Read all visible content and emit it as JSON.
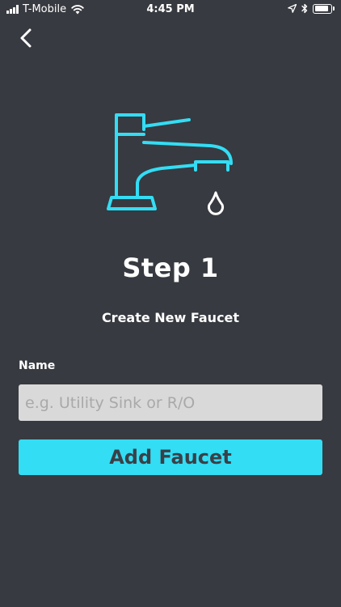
{
  "status_bar": {
    "carrier": "T-Mobile",
    "time": "4:45 PM",
    "icons": [
      "signal-icon",
      "wifi-icon",
      "location-arrow-icon",
      "bluetooth-icon",
      "battery-icon"
    ],
    "battery_level": 0.85
  },
  "nav": {
    "back_icon": "chevron-left-icon"
  },
  "hero": {
    "icon": "faucet-icon",
    "accent_color": "#33ddf4",
    "drop_color": "#ffffff"
  },
  "step": {
    "title": "Step 1",
    "subtitle": "Create New Faucet"
  },
  "form": {
    "name_label": "Name",
    "name_value": "",
    "name_placeholder": "e.g. Utility Sink or R/O",
    "submit_label": "Add Faucet"
  },
  "colors": {
    "background": "#373a40",
    "button": "#33ddf4",
    "button_text": "#3a4048",
    "input_background": "#d9d9d9"
  }
}
